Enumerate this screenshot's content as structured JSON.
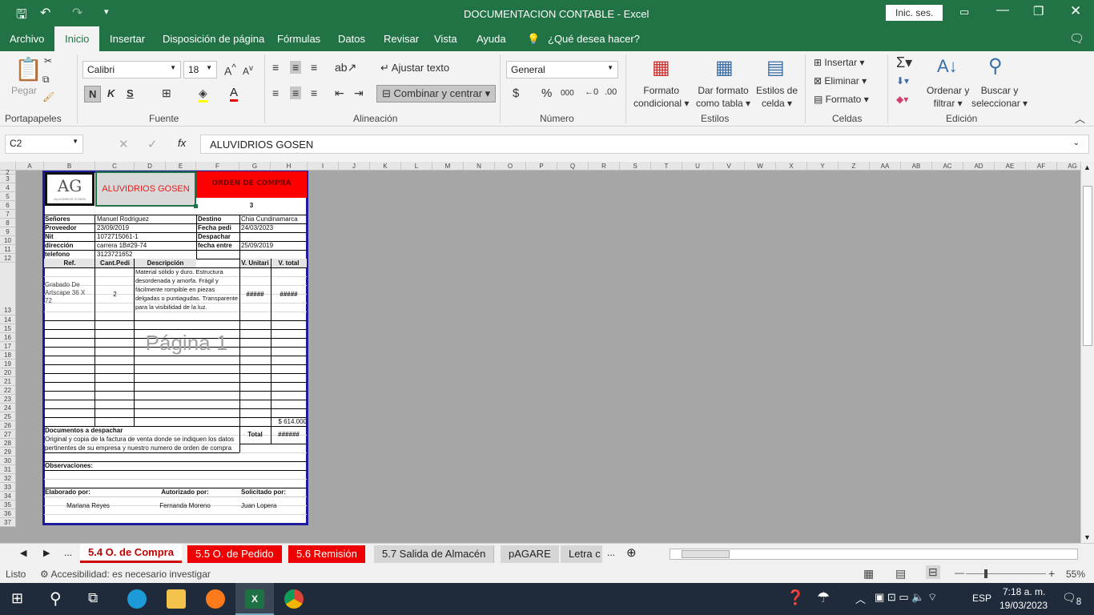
{
  "window": {
    "title": "DOCUMENTACION CONTABLE  -  Excel",
    "signin": "Inic. ses."
  },
  "menu": [
    "Archivo",
    "Inicio",
    "Insertar",
    "Disposición de página",
    "Fórmulas",
    "Datos",
    "Revisar",
    "Vista",
    "Ayuda",
    "¿Qué desea hacer?"
  ],
  "ribbon": {
    "paste": "Pegar",
    "font_name": "Calibri",
    "font_size": "18",
    "bold": "N",
    "italic": "K",
    "underline": "S",
    "wrap": "Ajustar texto",
    "merge": "Combinar y centrar",
    "number_format": "General",
    "currency": "$",
    "percent": "%",
    "thousands": "000",
    "cond_format": [
      "Formato",
      "condicional"
    ],
    "table_format": [
      "Dar formato",
      "como tabla"
    ],
    "cell_styles": [
      "Estilos de",
      "celda"
    ],
    "insert": "Insertar",
    "delete": "Eliminar",
    "format": "Formato",
    "sort": [
      "Ordenar y",
      "filtrar"
    ],
    "find": [
      "Buscar y",
      "seleccionar"
    ],
    "groups": [
      "Portapapeles",
      "Fuente",
      "Alineación",
      "Número",
      "Estilos",
      "Celdas",
      "Edición"
    ]
  },
  "formula_bar": {
    "name_box": "C2",
    "fx": "fx",
    "value": "ALUVIDRIOS GOSEN"
  },
  "columns": [
    "A",
    "B",
    "C",
    "D",
    "E",
    "F",
    "G",
    "H",
    "I",
    "J",
    "K",
    "L",
    "M",
    "N",
    "O",
    "P",
    "Q",
    "R",
    "S",
    "T",
    "U",
    "V",
    "W",
    "X",
    "Y",
    "Z",
    "AA",
    "AB",
    "AC",
    "AD",
    "AE",
    "AF",
    "AG"
  ],
  "rows": [
    "2",
    "3",
    "4",
    "5",
    "6",
    "7",
    "8",
    "9",
    "10",
    "11",
    "12",
    "13",
    "14",
    "15",
    "16",
    "17",
    "18",
    "19",
    "20",
    "21",
    "22",
    "23",
    "24",
    "25",
    "26",
    "27",
    "28",
    "29",
    "30",
    "31",
    "32",
    "33",
    "34",
    "35",
    "36",
    "37"
  ],
  "form": {
    "logo": "AG",
    "logo_sub": "ALUVIDRIOS GOSEN",
    "company": "ALUVIDRIOS GOSEN",
    "title": "ORDEN DE COMPRA",
    "number": "3",
    "fields_left": [
      {
        "label": "Señores",
        "value": "Manuel Rodriguez"
      },
      {
        "label": "Proveedor",
        "value": "23/09/2019"
      },
      {
        "label": "Nit",
        "value": "1072715061-1"
      },
      {
        "label": "dirección",
        "value": "carrera 1B#29-74"
      },
      {
        "label": "telefono",
        "value": "3123721652"
      }
    ],
    "fields_right": [
      {
        "label": "Destino",
        "value": "Chia Cundinamarca"
      },
      {
        "label": "Fecha pedi",
        "value": "24/03/2023"
      },
      {
        "label": "Despachar",
        "value": ""
      },
      {
        "label": "fecha entre",
        "value": "25/09/2019"
      }
    ],
    "headers": [
      "Ref.",
      "Cant.Pedi",
      "Descripción",
      "V. Unitari",
      "V. total"
    ],
    "item": {
      "ref": "Grabado De Artscape 36 X 72",
      "qty": "2",
      "desc": "Material sólido y duro. Estructura desordenada y amorfa. Frágil y fácilmente rompible en piezas delgadas o puntiagudas. Transparente para la visibilidad de la luz.",
      "unit": "#####",
      "total": "#####"
    },
    "page_watermark": "Página 1",
    "subtotal": "$ 614.000",
    "docs_label": "Documentos a despachar",
    "docs_text": [
      "Original y copia de la factura de venta donde se indiquen los datos",
      "pertinentes de su empresa y nuestro numero de orden de compra"
    ],
    "total_label": "Total",
    "total_value": "######",
    "obs_label": "Observaciones:",
    "signers": [
      {
        "label": "Elaborado por:",
        "name": "Mariana Reyes"
      },
      {
        "label": "Autorizado por:",
        "name": "Fernanda Moreno"
      },
      {
        "label": "Solicitado por:",
        "name": "Juan Lopera"
      }
    ]
  },
  "sheet_tabs": [
    "5.4 O. de Compra",
    "5.5 O. de Pedido",
    "5.6 Remisión",
    "5.7 Salida de Almacén",
    "pAGARE",
    "Letra c"
  ],
  "status": {
    "ready": "Listo",
    "accessibility": "Accesibilidad: es necesario investigar",
    "zoom": "55%"
  },
  "taskbar": {
    "lang": "ESP",
    "time": "7:18 a. m.",
    "date": "19/03/2023",
    "notif": "8"
  }
}
